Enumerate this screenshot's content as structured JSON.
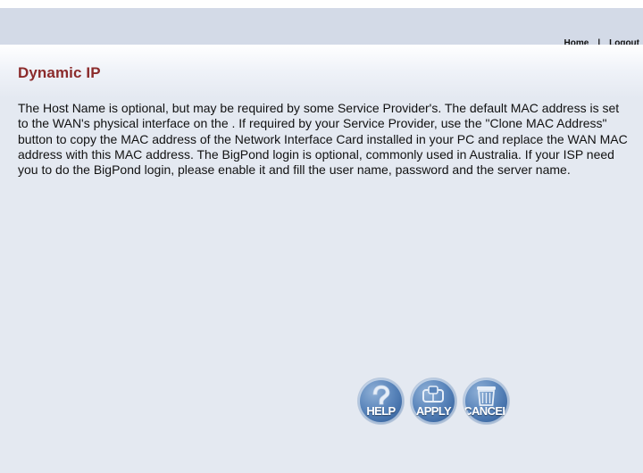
{
  "header": {
    "nav": {
      "home": "Home",
      "separator": "|",
      "logout": "Logout"
    }
  },
  "content": {
    "title": "Dynamic IP",
    "description": "The Host Name is optional, but may be required by some Service Provider's. The default MAC address is set to the WAN's physical interface on the . If required by your Service Provider, use the \"Clone MAC Address\" button to copy the MAC address of the Network Interface Card installed in your PC and replace the WAN MAC address with this MAC address. The BigPond login is optional, commonly used in Australia. If your ISP need you to do the BigPond login, please enable it and fill the user name, password and the server name."
  },
  "buttons": {
    "help": {
      "label": "HELP",
      "icon": "question-mark-icon"
    },
    "apply": {
      "label": "APPLY",
      "icon": "apply-icon"
    },
    "cancel": {
      "label": "CANCEL",
      "icon": "trash-icon"
    }
  },
  "colors": {
    "header_bar": "#d3dae7",
    "content_bg": "#e4e9f1",
    "title": "#8b2b2b",
    "button_blue": "#3d6aa4"
  }
}
